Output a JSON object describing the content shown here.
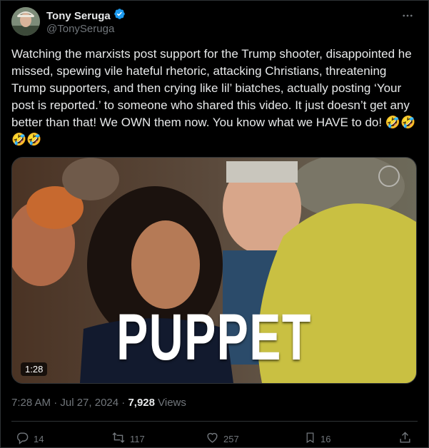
{
  "author": {
    "display_name": "Tony Seruga",
    "handle": "@TonySeruga"
  },
  "tweet": {
    "text": "Watching the marxists post support for the Trump shooter, disappointed he missed, spewing vile hateful rhetoric, attacking Christians, threatening Trump supporters, and then crying like lil’ biatches, actually posting ‘Your post is reported.’ to someone who shared this video. It just doesn’t get any better than that! We OWN them now. You know what we HAVE to do! ",
    "emojis": "🤣🤣🤣🤣"
  },
  "media": {
    "overlay_text": "PUPPET",
    "duration": "1:28"
  },
  "meta": {
    "timestamp": "7:28 AM · Jul 27, 2024 · ",
    "views_count": "7,928",
    "views_label": " Views"
  },
  "actions": {
    "replies": "14",
    "reposts": "117",
    "likes": "257",
    "bookmarks": "16"
  },
  "colors": {
    "background": "#000000",
    "text": "#e7e9ea",
    "secondary": "#71767b",
    "verified": "#1d9bf0",
    "border": "#2f3336"
  }
}
